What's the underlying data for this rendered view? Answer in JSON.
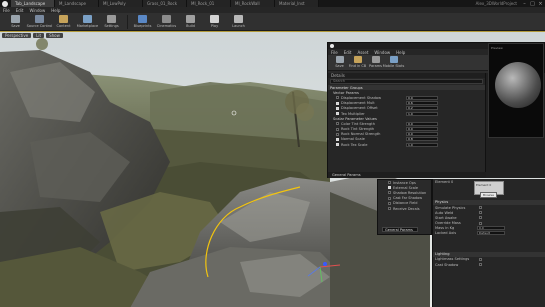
{
  "app": {
    "tabs": [
      {
        "label": "Tab_Landscape",
        "active": true
      },
      {
        "label": "M_Landscape"
      },
      {
        "label": "MI_LowPoly"
      },
      {
        "label": "Grass_01_Rock"
      },
      {
        "label": "MI_Rock_01"
      },
      {
        "label": "MI_RockWall"
      },
      {
        "label": "Material_Inst"
      }
    ],
    "project": "Alex_3DWorldProject"
  },
  "menubar": [
    "File",
    "Edit",
    "Window",
    "Help"
  ],
  "toolbar": [
    {
      "label": "Save",
      "icon": "save-icon",
      "color": "#9aa4ad"
    },
    {
      "label": "Source Control",
      "icon": "source-control-icon",
      "color": "#7a8aa0"
    },
    {
      "label": "Content",
      "icon": "content-icon",
      "color": "#c6a35a"
    },
    {
      "label": "Marketplace",
      "icon": "marketplace-icon",
      "color": "#7aa0c6"
    },
    {
      "label": "Settings",
      "icon": "settings-icon",
      "color": "#9a9a9a"
    },
    {
      "label": "Blueprints",
      "icon": "blueprints-icon",
      "color": "#5a88c6"
    },
    {
      "label": "Cinematics",
      "icon": "cinematics-icon",
      "color": "#8c8c8c"
    },
    {
      "label": "Build",
      "icon": "build-icon",
      "color": "#a0a0a0"
    },
    {
      "label": "Play",
      "icon": "play-icon",
      "color": "#d4d4d4"
    },
    {
      "label": "Launch",
      "icon": "launch-icon",
      "color": "#b8b8b8"
    }
  ],
  "viewport": {
    "chips": [
      "Perspective",
      "Lit",
      "Show"
    ],
    "level": "Level: Map (Persistent)"
  },
  "material_window": {
    "menu": [
      "File",
      "Edit",
      "Asset",
      "Window",
      "Help"
    ],
    "toolbar": [
      {
        "label": "Save",
        "icon": "save-icon",
        "color": "#9aa4ad"
      },
      {
        "label": "Find in CB",
        "icon": "find-icon",
        "color": "#c6a35a"
      },
      {
        "label": "Params",
        "icon": "params-icon",
        "color": "#9a9a9a"
      },
      {
        "label": "Mobile Stats",
        "icon": "stats-icon",
        "color": "#7aa0c6"
      }
    ],
    "details_title": "Details",
    "search_placeholder": "Search",
    "groups": [
      {
        "title": "Parameter Groups",
        "rows": []
      },
      {
        "title": "Vector Params",
        "rows": [
          {
            "name": "Displacement Shadow",
            "on": false,
            "value": "0.0"
          },
          {
            "name": "Displacement Mult",
            "on": true,
            "value": "0.6"
          },
          {
            "name": "Displacement Offset",
            "on": true,
            "value": "0.2"
          },
          {
            "name": "Tex Multiplier",
            "on": true,
            "value": "1.0"
          }
        ]
      },
      {
        "title": "Scalar Parameter Values",
        "rows": [
          {
            "name": "Color Tint Strength",
            "on": false,
            "value": "0.0"
          },
          {
            "name": "Rock Tint Strength",
            "on": false,
            "value": "0.0"
          },
          {
            "name": "Rock Normal Strength",
            "on": false,
            "value": "0.0"
          },
          {
            "name": "Normal Scale",
            "on": true,
            "value": "0.8"
          },
          {
            "name": "Rock Tex Scale",
            "on": true,
            "value": "1.0"
          }
        ]
      }
    ],
    "footer": "General Params",
    "preview_label": "Preview"
  },
  "mid_panel": {
    "rows": [
      {
        "name": "Instance Ops",
        "on": false
      },
      {
        "name": "External Scale",
        "on": true
      },
      {
        "name": "Shadow Resolution",
        "on": false
      },
      {
        "name": "Cast Far Shadow",
        "on": false
      },
      {
        "name": "Distance Field",
        "on": false
      },
      {
        "name": "Receive Decals",
        "on": false
      }
    ],
    "button": "General Params"
  },
  "details2": {
    "rows": [
      {
        "name": "Element 0",
        "cat": false
      },
      {
        "name": "",
        "cat": false
      },
      {
        "name": "",
        "cat": false
      },
      {
        "name": "",
        "cat": false
      },
      {
        "name": "Physics",
        "cat": true
      },
      {
        "name": "Simulate Physics",
        "cat": false
      },
      {
        "name": "Auto Weld",
        "cat": false
      },
      {
        "name": "Start Awake",
        "cat": false
      },
      {
        "name": "Override Mass",
        "cat": false
      },
      {
        "name": "Mass in Kg",
        "cat": false,
        "value": "0.0"
      },
      {
        "name": "Locked Axis",
        "cat": false,
        "value": "Default"
      },
      {
        "name": "",
        "cat": false
      },
      {
        "name": "",
        "cat": false
      },
      {
        "name": "",
        "cat": false
      },
      {
        "name": "Lighting",
        "cat": true
      },
      {
        "name": "Lightmass Settings",
        "cat": false
      },
      {
        "name": "Cast Shadow",
        "cat": false
      }
    ],
    "thumb_label": "Element 0",
    "thumb_button": "Browse"
  }
}
